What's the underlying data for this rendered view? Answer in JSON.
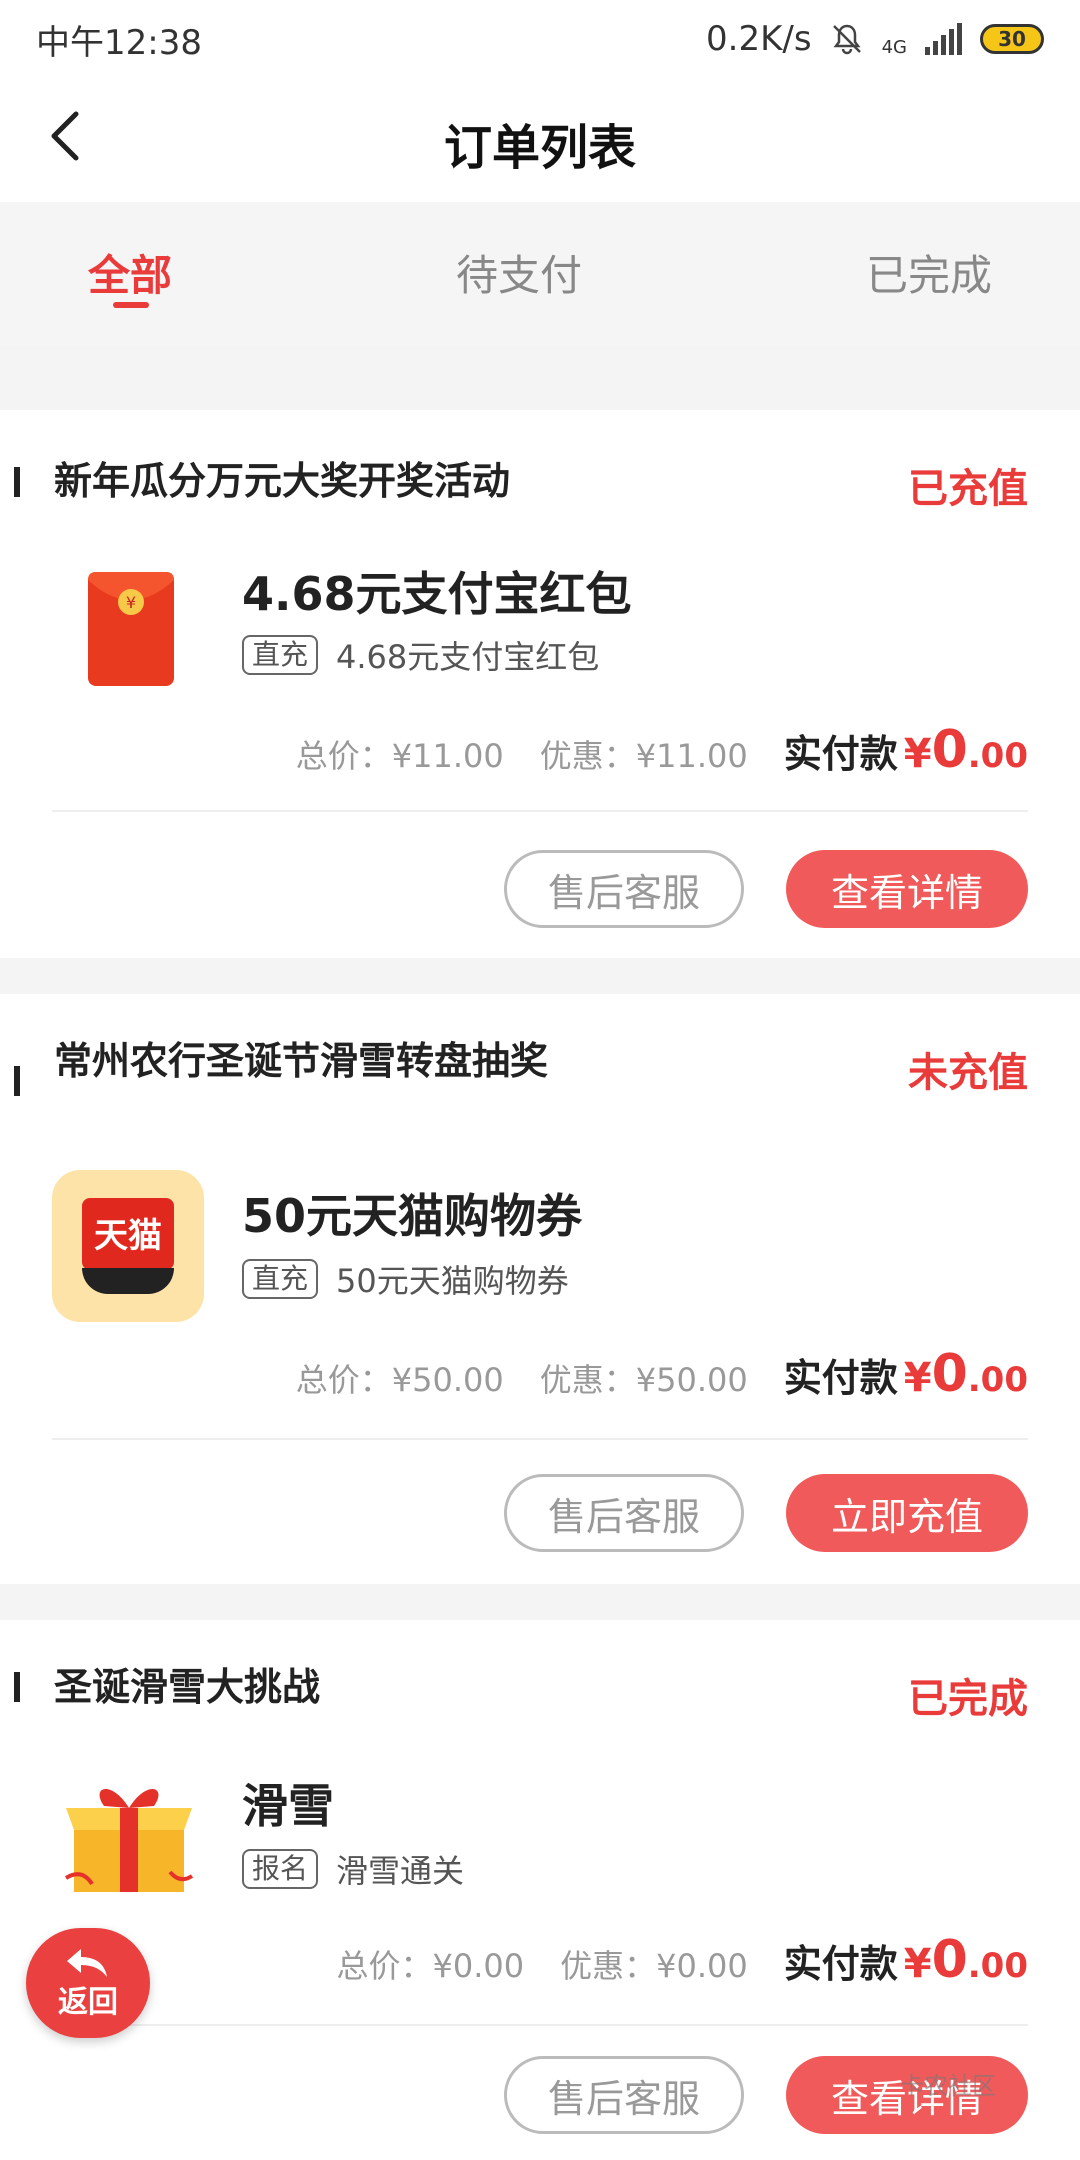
{
  "status_bar": {
    "time": "中午12:38",
    "speed": "0.2K/s",
    "network": "4G",
    "battery": "30"
  },
  "header": {
    "title": "订单列表"
  },
  "tabs": [
    {
      "label": "全部",
      "active": true
    },
    {
      "label": "待支付",
      "active": false
    },
    {
      "label": "已完成",
      "active": false
    }
  ],
  "orders": [
    {
      "title": "新年瓜分万元大奖开奖活动",
      "status": "已充值",
      "product_name": "4.68元支付宝红包",
      "tag": "直充",
      "desc": "4.68元支付宝红包",
      "total": "总价：¥11.00",
      "discount": "优惠：¥11.00",
      "pay_label": "实付款",
      "pay_symbol": "¥",
      "pay_int": "0",
      "pay_dec": ".00",
      "btn_left": "售后客服",
      "btn_right": "查看详情",
      "icon": "red-envelope-icon"
    },
    {
      "title": "常州农行圣诞节滑雪转盘抽奖",
      "status": "未充值",
      "product_name": "50元天猫购物券",
      "tag": "直充",
      "desc": "50元天猫购物券",
      "logo_text": "天猫",
      "total": "总价：¥50.00",
      "discount": "优惠：¥50.00",
      "pay_label": "实付款",
      "pay_symbol": "¥",
      "pay_int": "0",
      "pay_dec": ".00",
      "btn_left": "售后客服",
      "btn_right": "立即充值",
      "icon": "tmall-logo-icon"
    },
    {
      "title": "圣诞滑雪大挑战",
      "status": "已完成",
      "product_name": "滑雪",
      "tag": "报名",
      "desc": "滑雪通关",
      "total": "总价：¥0.00",
      "discount": "优惠：¥0.00",
      "pay_label": "实付款",
      "pay_symbol": "¥",
      "pay_int": "0",
      "pay_dec": ".00",
      "btn_left": "售后客服",
      "btn_right": "查看详情",
      "icon": "gift-box-icon"
    }
  ],
  "float_back": {
    "label": "返回"
  },
  "watermark": "卡农社区",
  "colors": {
    "accent": "#ea3b3b",
    "button_red": "#f05a5a"
  }
}
